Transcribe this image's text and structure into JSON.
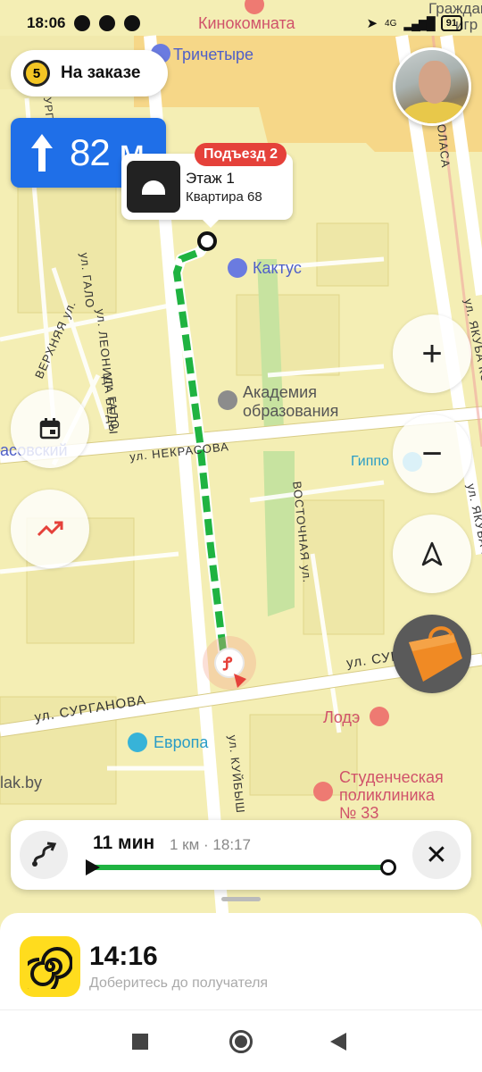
{
  "status_bar": {
    "time": "18:06",
    "battery": "91",
    "network": "4G"
  },
  "order_pill": {
    "count": "5",
    "label": "На заказе"
  },
  "maneuver": {
    "distance": "82 м",
    "direction_icon": "arrow-up-icon"
  },
  "destination": {
    "entrance": "Подъезд 2",
    "floor": "Этаж 1",
    "apartment": "Квартира 68"
  },
  "map_pois": {
    "cinema": "Кинокомната",
    "trichetyre": "Тричетыре",
    "kaktus": "Кактус",
    "academy_line1": "Академия",
    "academy_line2": "образования",
    "gippo": "Гиппо",
    "lode": "Лодэ",
    "evropa": "Европа",
    "polyclinic_line1": "Студенческая",
    "polyclinic_line2": "поликлиника",
    "polyclinic_line3": "№ 33",
    "lak": "lak.by",
    "tarasovsky": "асовский",
    "grazhd": "Граждан",
    "migr": "игр"
  },
  "map_streets": {
    "leonida_bedy": "ул. ЛЕОНИДА БЕДЫ",
    "nekrasova": "ул. НЕКРАСОВА",
    "surganova": "ул. СУРГАНОВА",
    "surganova_right": "ул. СУР",
    "kuybysheva": "ул. КУЙБЫШ",
    "vostochnaya": "ВОСТОЧНАЯ ул.",
    "kolasa": "АКОЛАСА",
    "yakuba_kolasa": "ул. ЯКУБА КОЛАСА",
    "yakuba_kolasa2": "ул. ЯКУБА КОЛ",
    "galo": "ул. ГАЛО",
    "galo2": "ул. ГАЛО",
    "verkhnyaya": "ВЕРХНЯЯ ул.",
    "urgal": "УРГАЛ"
  },
  "route": {
    "time": "11 мин",
    "meta": "1 км · 18:17",
    "progress": 1.0
  },
  "eta": {
    "time": "14:16",
    "subtitle": "Доберитесь до получателя"
  },
  "colors": {
    "route": "#1fb341",
    "maneuver": "#1f6fe8",
    "entrance": "#e5413a",
    "app_yellow": "#ffdc1e"
  }
}
